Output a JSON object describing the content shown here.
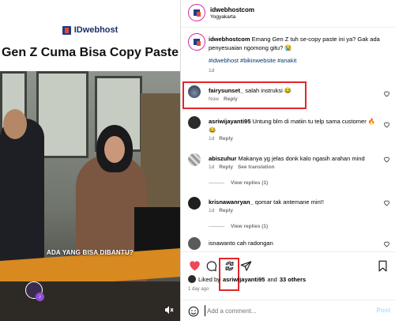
{
  "video": {
    "brand": "IDwebhost",
    "title": "Gen Z Cuma Bisa Copy Paste",
    "caption": "ADA YANG BISA DIBANTU?"
  },
  "header": {
    "username": "idwebhostcom",
    "location": "Yogyakarta"
  },
  "post": {
    "username": "idwebhostcom",
    "text": "Emang Gen Z tuh se-copy paste ini ya? Gak ada penyesuaian ngomong gitu? 😭",
    "hashtags": "#idwebhost #bikinwebsite #anakit",
    "age": "1d"
  },
  "comments": [
    {
      "username": "fairysunset_",
      "text": "salah instruksi 😂",
      "age": "Now",
      "reply": "Reply"
    },
    {
      "username": "asriwijayanti95",
      "text": "Untung blm di matiin tu telp sama customer 🔥😂",
      "age": "1d",
      "reply": "Reply"
    },
    {
      "username": "abiszuhur",
      "text": "Makanya yg jelas donk kalo ngasih arahan mind",
      "age": "1d",
      "reply": "Reply",
      "extra": "See translation",
      "replies": "View replies (1)"
    },
    {
      "username": "krisnawanryan_",
      "text": "qomar tak antemane min!!",
      "age": "1d",
      "reply": "Reply",
      "replies": "View replies (1)"
    },
    {
      "username": "isnawanto",
      "text": "cah radongan",
      "age": "",
      "reply": ""
    }
  ],
  "likes": {
    "prefix": "Liked by",
    "user": "asriwijayanti95",
    "joiner": "and",
    "others": "33 others",
    "time": "1 day ago"
  },
  "add_comment": {
    "placeholder": "Add a comment...",
    "post_label": "Post"
  },
  "colors": {
    "heart": "#ed4956",
    "highlight": "#e2262b",
    "link": "#00376b",
    "post_disabled": "#b2dffc"
  }
}
